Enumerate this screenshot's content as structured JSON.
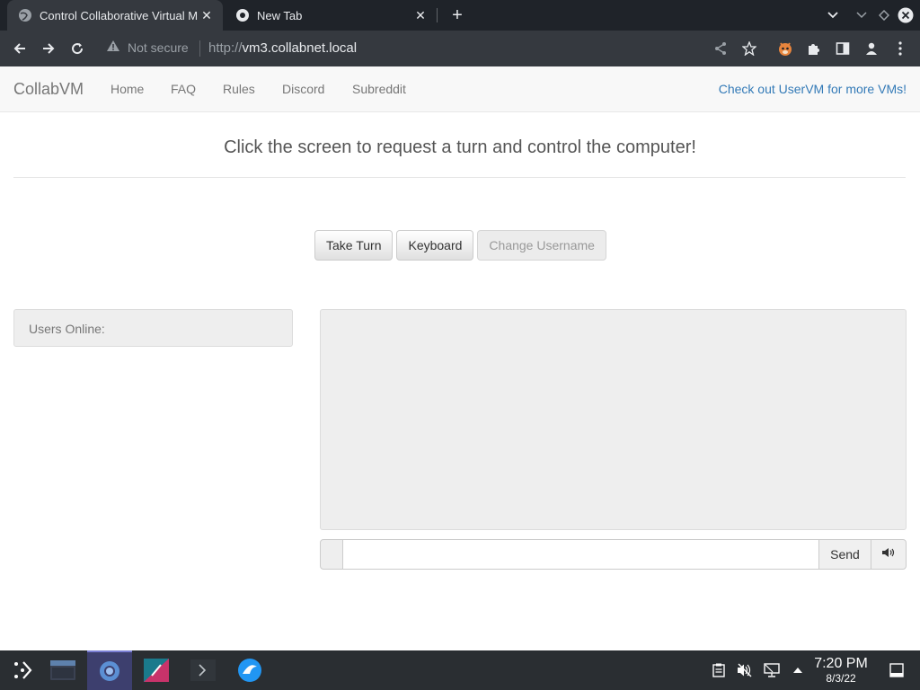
{
  "browser": {
    "tabs": [
      {
        "title": "Control Collaborative Virtual Machines!",
        "active": true
      },
      {
        "title": "New Tab",
        "active": false
      }
    ],
    "security_label": "Not secure",
    "url_scheme": "http://",
    "url_host": "vm3.collabnet.local"
  },
  "navbar": {
    "brand": "CollabVM",
    "links": [
      "Home",
      "FAQ",
      "Rules",
      "Discord",
      "Subreddit"
    ],
    "right_link": "Check out UserVM for more VMs!"
  },
  "main": {
    "headline": "Click the screen to request a turn and control the computer!",
    "buttons": {
      "take_turn": "Take Turn",
      "keyboard": "Keyboard",
      "change_username": "Change Username"
    },
    "users_online_label": "Users Online:",
    "chat": {
      "input_value": "",
      "send_label": "Send"
    }
  },
  "taskbar": {
    "time": "7:20 PM",
    "date": "8/3/22"
  },
  "colors": {
    "link": "#337ab7",
    "panel": "#eeeeee",
    "chrome_dark": "#1f2329",
    "taskbar": "#2a2e32"
  }
}
